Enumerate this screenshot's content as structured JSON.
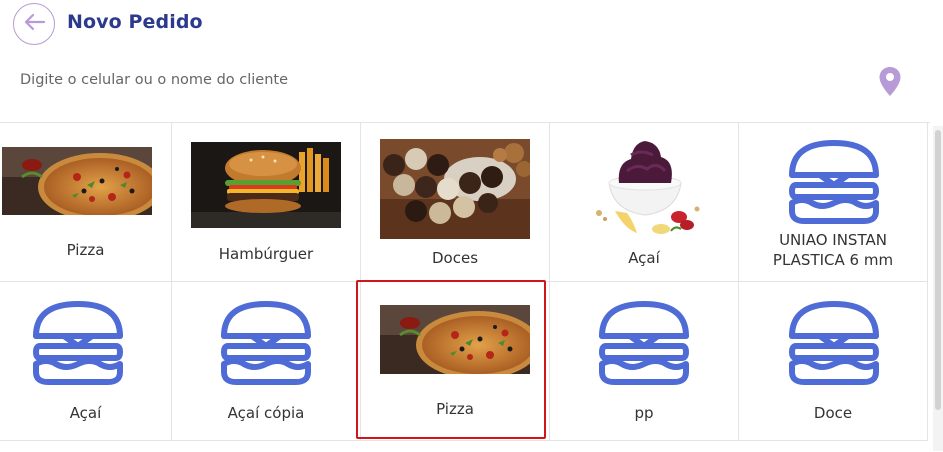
{
  "header": {
    "title": "Novo Pedido",
    "back_icon": "arrow-left-icon"
  },
  "search": {
    "placeholder": "Digite o celular ou o nome do cliente",
    "value": "",
    "location_icon": "map-pin-icon"
  },
  "colors": {
    "title": "#2b3a8c",
    "accent": "#b79bd6",
    "burger_icon": "#4f6bd6",
    "selection": "#d0161b"
  },
  "categories": [
    {
      "label": "Pizza",
      "image": "pizza-photo"
    },
    {
      "label": "Hambúrguer",
      "image": "burger-photo"
    },
    {
      "label": "Doces",
      "image": "sweets-photo"
    },
    {
      "label": "Açaí",
      "image": "acai-photo"
    },
    {
      "label": "UNIAO INSTAN PLASTICA 6 mm",
      "image": "hamburger-icon"
    },
    {
      "label": "Açaí",
      "image": "hamburger-icon"
    },
    {
      "label": "Açaí cópia",
      "image": "hamburger-icon"
    },
    {
      "label": "Pizza",
      "image": "pizza-photo",
      "selected": true
    },
    {
      "label": "pp",
      "image": "hamburger-icon"
    },
    {
      "label": "Doce",
      "image": "hamburger-icon"
    }
  ]
}
